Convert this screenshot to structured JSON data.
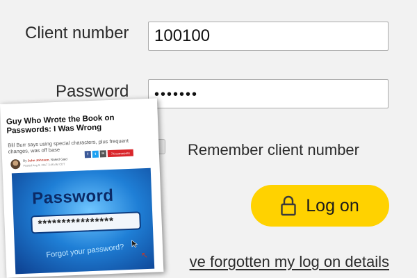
{
  "login": {
    "client_number_label": "Client number",
    "client_number_value": "100100",
    "password_label": "Password",
    "password_value": "•••••••",
    "remember_label": "Remember client number",
    "remember_checked": false,
    "logon_label": "Log on",
    "forgot_link": "ve forgotten my log on details",
    "accent_color": "#ffd200"
  },
  "article": {
    "headline": "Guy Who Wrote the Book on Passwords: I Was Wrong",
    "subhead": "Bill Burr says using special characters, plus frequent changes, was off base",
    "byline_prefix": "By",
    "author": "John Johnson",
    "source": "Naked Gaid",
    "dateline": "Posted Aug 9, 2017 3:46 AM CDT",
    "share": {
      "facebook": "f",
      "twitter": "t",
      "email": "✉",
      "comments": "74 comments"
    },
    "image": {
      "word": "Password",
      "field": "****************",
      "forgot": "Forgot your password?"
    }
  }
}
